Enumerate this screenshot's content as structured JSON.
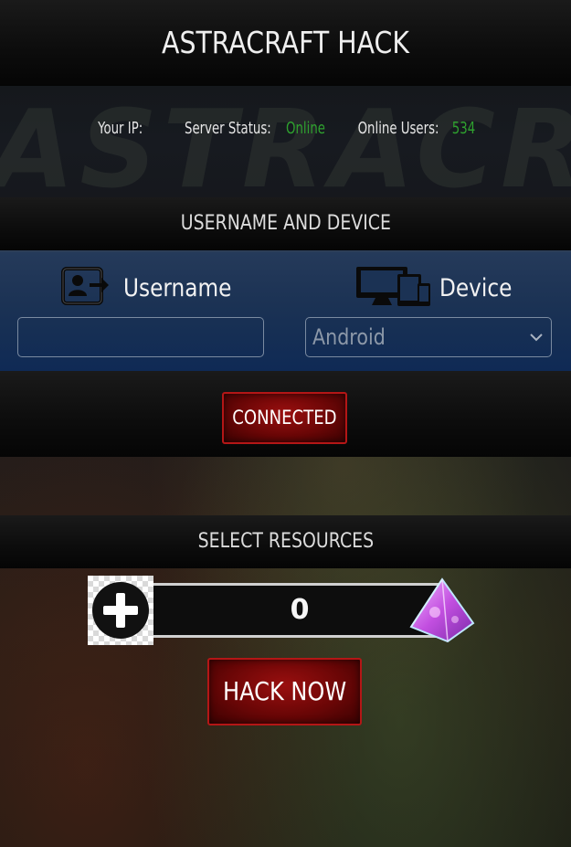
{
  "header": {
    "title": "ASTRACRAFT HACK"
  },
  "status": {
    "watermark": "ASTRACRAFT",
    "ip_label": "Your IP:",
    "ip_value": "",
    "server_label": "Server Status:",
    "server_value": "Online",
    "users_label": "Online Users:",
    "users_value": "534",
    "status_color": "#2fa12f"
  },
  "user_section": {
    "title": "USERNAME AND DEVICE",
    "username_label": "Username",
    "username_value": "",
    "device_label": "Device",
    "device_value": "Android"
  },
  "connect": {
    "label": "CONNECTED"
  },
  "resources": {
    "title": "SELECT RESOURCES",
    "amount": "0",
    "plus_icon": "plus-circle-icon",
    "resource_icon": "crystal-gem-icon"
  },
  "hack": {
    "label": "HACK NOW"
  },
  "colors": {
    "button_red": "#8b0a0a",
    "panel_blue": "#1b3254"
  }
}
